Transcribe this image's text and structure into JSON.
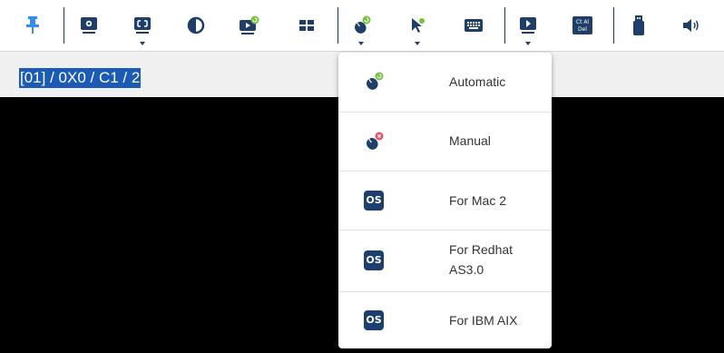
{
  "colors": {
    "accent": "#1f3e68",
    "pin_blue": "#2f8ef0",
    "selection": "#1b5ab5",
    "badge_green": "#7ac143",
    "badge_red": "#e05561"
  },
  "toolbar": {
    "buttons": [
      {
        "name": "pin-icon"
      },
      {
        "name": "settings-icon"
      },
      {
        "name": "fullscreen-icon"
      },
      {
        "name": "contrast-icon"
      },
      {
        "name": "video-auto-icon"
      },
      {
        "name": "layout-grid-icon"
      },
      {
        "name": "mouse-sync-icon"
      },
      {
        "name": "cursor-icon"
      },
      {
        "name": "keyboard-icon"
      },
      {
        "name": "play-icon"
      },
      {
        "name": "ctrl-alt-del-icon",
        "label_top": "Ct Al",
        "label_bottom": "Del"
      },
      {
        "name": "usb-icon"
      },
      {
        "name": "volume-icon"
      }
    ]
  },
  "status": {
    "path": "[01] / 0X0 / C1 / 2"
  },
  "mouse_menu": {
    "items": [
      {
        "label": "Automatic",
        "icon": "mouse-automatic-icon"
      },
      {
        "label": "Manual",
        "icon": "mouse-manual-icon"
      },
      {
        "label": "For Mac 2",
        "icon": "os-icon",
        "badge": "OS"
      },
      {
        "label": "For Redhat\nAS3.0",
        "icon": "os-icon",
        "badge": "OS"
      },
      {
        "label": "For IBM AIX",
        "icon": "os-icon",
        "badge": "OS"
      }
    ]
  }
}
